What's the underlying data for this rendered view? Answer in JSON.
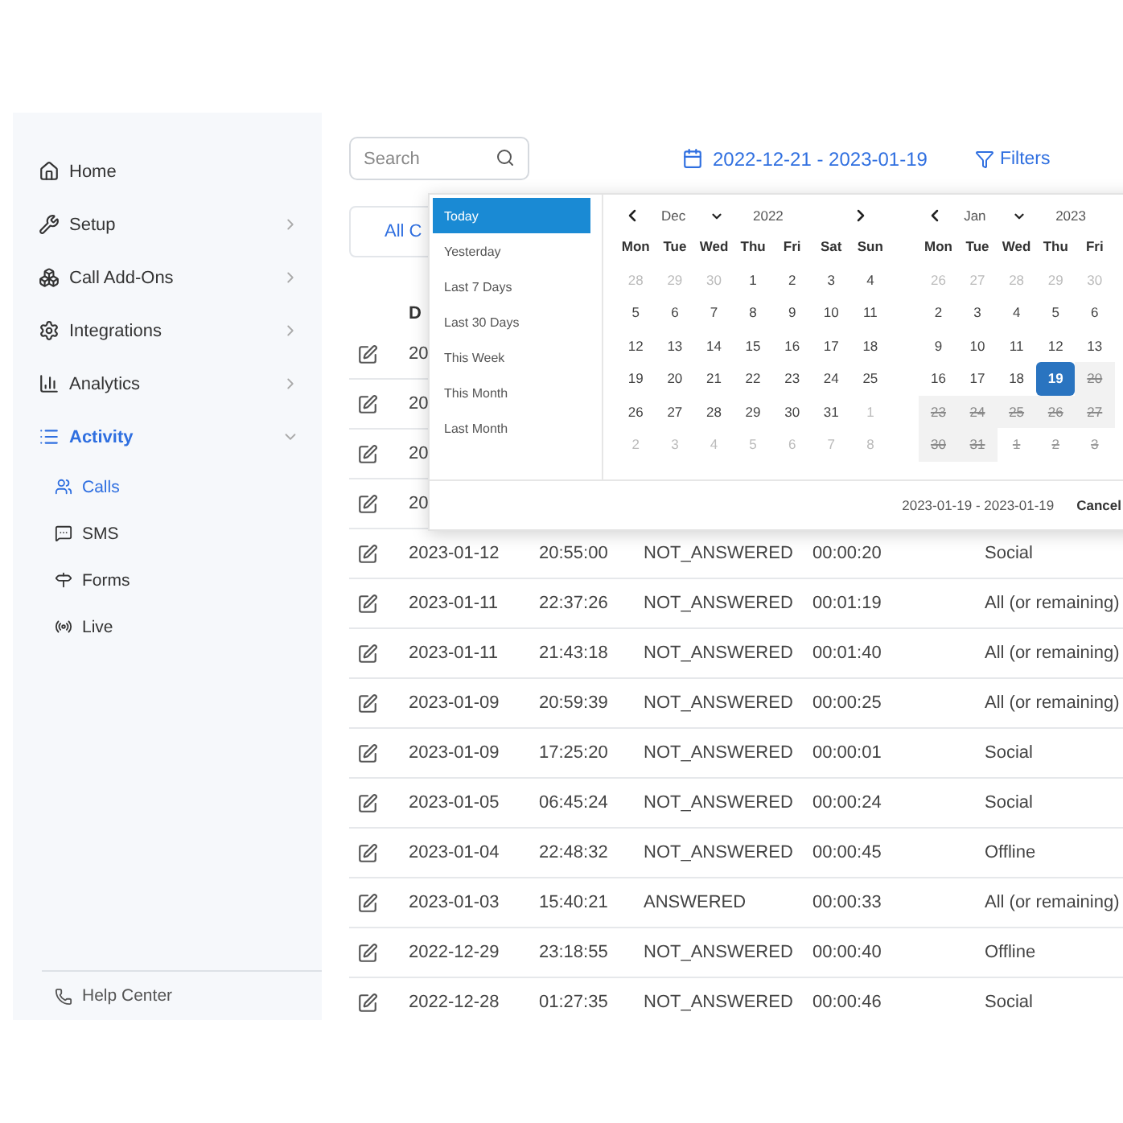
{
  "sidebar": {
    "items": [
      {
        "kind": "link",
        "label": "Home",
        "selected": false
      },
      {
        "kind": "group",
        "label": "Setup",
        "selected": false,
        "expanded": false
      },
      {
        "kind": "group",
        "label": "Call Add-Ons",
        "selected": false,
        "expanded": false
      },
      {
        "kind": "group",
        "label": "Integrations",
        "selected": false,
        "expanded": false
      },
      {
        "kind": "group",
        "label": "Analytics",
        "selected": false,
        "expanded": false
      },
      {
        "kind": "group",
        "label": "Activity",
        "selected": true,
        "expanded": true,
        "children": [
          {
            "label": "Calls",
            "selected": true
          },
          {
            "label": "SMS",
            "selected": false
          },
          {
            "label": "Forms",
            "selected": false
          },
          {
            "label": "Live",
            "selected": false
          }
        ]
      }
    ],
    "help": "Help Center"
  },
  "toolbar": {
    "search": {
      "placeholder": "Search"
    },
    "date_range": "2022-12-21 - 2023-01-19",
    "filters": "Filters"
  },
  "tabs": [
    {
      "label": "All C",
      "selected": true
    }
  ],
  "table": {
    "columns": [
      "D"
    ],
    "rows": [
      {
        "cells": [
          "20"
        ]
      },
      {
        "cells": [
          "20"
        ]
      },
      {
        "cells": [
          "20"
        ]
      },
      {
        "cells": [
          "20"
        ]
      },
      {
        "cells": [
          "2023-01-12",
          "20:55:00",
          "NOT_ANSWERED",
          "00:00:20",
          "Social"
        ]
      },
      {
        "cells": [
          "2023-01-11",
          "22:37:26",
          "NOT_ANSWERED",
          "00:01:19",
          "All (or remaining)"
        ]
      },
      {
        "cells": [
          "2023-01-11",
          "21:43:18",
          "NOT_ANSWERED",
          "00:01:40",
          "All (or remaining)"
        ]
      },
      {
        "cells": [
          "2023-01-09",
          "20:59:39",
          "NOT_ANSWERED",
          "00:00:25",
          "All (or remaining)"
        ]
      },
      {
        "cells": [
          "2023-01-09",
          "17:25:20",
          "NOT_ANSWERED",
          "00:00:01",
          "Social"
        ]
      },
      {
        "cells": [
          "2023-01-05",
          "06:45:24",
          "NOT_ANSWERED",
          "00:00:24",
          "Social"
        ]
      },
      {
        "cells": [
          "2023-01-04",
          "22:48:32",
          "NOT_ANSWERED",
          "00:00:45",
          "Offline"
        ]
      },
      {
        "cells": [
          "2023-01-03",
          "15:40:21",
          "ANSWERED",
          "00:00:33",
          "All (or remaining)"
        ]
      },
      {
        "cells": [
          "2022-12-29",
          "23:18:55",
          "NOT_ANSWERED",
          "00:00:40",
          "Offline"
        ]
      },
      {
        "cells": [
          "2022-12-28",
          "01:27:35",
          "NOT_ANSWERED",
          "00:00:46",
          "Social"
        ]
      }
    ]
  },
  "date_picker": {
    "presets": [
      {
        "label": "Today",
        "selected": true
      },
      {
        "label": "Yesterday",
        "selected": false
      },
      {
        "label": "Last 7 Days",
        "selected": false
      },
      {
        "label": "Last 30 Days",
        "selected": false
      },
      {
        "label": "This Week",
        "selected": false
      },
      {
        "label": "This Month",
        "selected": false
      },
      {
        "label": "Last Month",
        "selected": false
      }
    ],
    "calendars": [
      {
        "month": "Dec",
        "year": "2022",
        "next_arrow": true,
        "weekdays": [
          "Mon",
          "Tue",
          "Wed",
          "Thu",
          "Fri",
          "Sat",
          "Sun"
        ],
        "weeks": [
          [
            {
              "day": "28",
              "kind": "muted"
            },
            {
              "day": "29",
              "kind": "muted"
            },
            {
              "day": "30",
              "kind": "muted"
            },
            {
              "day": "1",
              "kind": "normal"
            },
            {
              "day": "2",
              "kind": "normal"
            },
            {
              "day": "3",
              "kind": "normal"
            },
            {
              "day": "4",
              "kind": "normal"
            }
          ],
          [
            {
              "day": "5",
              "kind": "normal"
            },
            {
              "day": "6",
              "kind": "normal"
            },
            {
              "day": "7",
              "kind": "normal"
            },
            {
              "day": "8",
              "kind": "normal"
            },
            {
              "day": "9",
              "kind": "normal"
            },
            {
              "day": "10",
              "kind": "normal"
            },
            {
              "day": "11",
              "kind": "normal"
            }
          ],
          [
            {
              "day": "12",
              "kind": "normal"
            },
            {
              "day": "13",
              "kind": "normal"
            },
            {
              "day": "14",
              "kind": "normal"
            },
            {
              "day": "15",
              "kind": "normal"
            },
            {
              "day": "16",
              "kind": "normal"
            },
            {
              "day": "17",
              "kind": "normal"
            },
            {
              "day": "18",
              "kind": "normal"
            }
          ],
          [
            {
              "day": "19",
              "kind": "normal"
            },
            {
              "day": "20",
              "kind": "normal"
            },
            {
              "day": "21",
              "kind": "normal"
            },
            {
              "day": "22",
              "kind": "normal"
            },
            {
              "day": "23",
              "kind": "normal"
            },
            {
              "day": "24",
              "kind": "normal"
            },
            {
              "day": "25",
              "kind": "normal"
            }
          ],
          [
            {
              "day": "26",
              "kind": "normal"
            },
            {
              "day": "27",
              "kind": "normal"
            },
            {
              "day": "28",
              "kind": "normal"
            },
            {
              "day": "29",
              "kind": "normal"
            },
            {
              "day": "30",
              "kind": "normal"
            },
            {
              "day": "31",
              "kind": "normal"
            },
            {
              "day": "1",
              "kind": "muted"
            }
          ],
          [
            {
              "day": "2",
              "kind": "muted"
            },
            {
              "day": "3",
              "kind": "muted"
            },
            {
              "day": "4",
              "kind": "muted"
            },
            {
              "day": "5",
              "kind": "muted"
            },
            {
              "day": "6",
              "kind": "muted"
            },
            {
              "day": "7",
              "kind": "muted"
            },
            {
              "day": "8",
              "kind": "muted"
            }
          ]
        ]
      },
      {
        "month": "Jan",
        "year": "2023",
        "next_arrow": false,
        "weekdays": [
          "Mon",
          "Tue",
          "Wed",
          "Thu",
          "Fri"
        ],
        "weeks": [
          [
            {
              "day": "26",
              "kind": "muted"
            },
            {
              "day": "27",
              "kind": "muted"
            },
            {
              "day": "28",
              "kind": "muted"
            },
            {
              "day": "29",
              "kind": "muted"
            },
            {
              "day": "30",
              "kind": "muted"
            }
          ],
          [
            {
              "day": "2",
              "kind": "normal"
            },
            {
              "day": "3",
              "kind": "normal"
            },
            {
              "day": "4",
              "kind": "normal"
            },
            {
              "day": "5",
              "kind": "normal"
            },
            {
              "day": "6",
              "kind": "normal"
            }
          ],
          [
            {
              "day": "9",
              "kind": "normal"
            },
            {
              "day": "10",
              "kind": "normal"
            },
            {
              "day": "11",
              "kind": "normal"
            },
            {
              "day": "12",
              "kind": "normal"
            },
            {
              "day": "13",
              "kind": "normal"
            }
          ],
          [
            {
              "day": "16",
              "kind": "normal"
            },
            {
              "day": "17",
              "kind": "normal"
            },
            {
              "day": "18",
              "kind": "normal"
            },
            {
              "day": "19",
              "kind": "selected"
            },
            {
              "day": "20",
              "kind": "disabled"
            }
          ],
          [
            {
              "day": "23",
              "kind": "disabled"
            },
            {
              "day": "24",
              "kind": "disabled"
            },
            {
              "day": "25",
              "kind": "disabled"
            },
            {
              "day": "26",
              "kind": "disabled"
            },
            {
              "day": "27",
              "kind": "disabled"
            }
          ],
          [
            {
              "day": "30",
              "kind": "disabled"
            },
            {
              "day": "31",
              "kind": "disabled"
            },
            {
              "day": "1",
              "kind": "muted-disabled"
            },
            {
              "day": "2",
              "kind": "muted-disabled"
            },
            {
              "day": "3",
              "kind": "muted-disabled"
            }
          ]
        ]
      }
    ],
    "selected_range": "2023-01-19 - 2023-01-19",
    "cancel": "Cancel"
  }
}
